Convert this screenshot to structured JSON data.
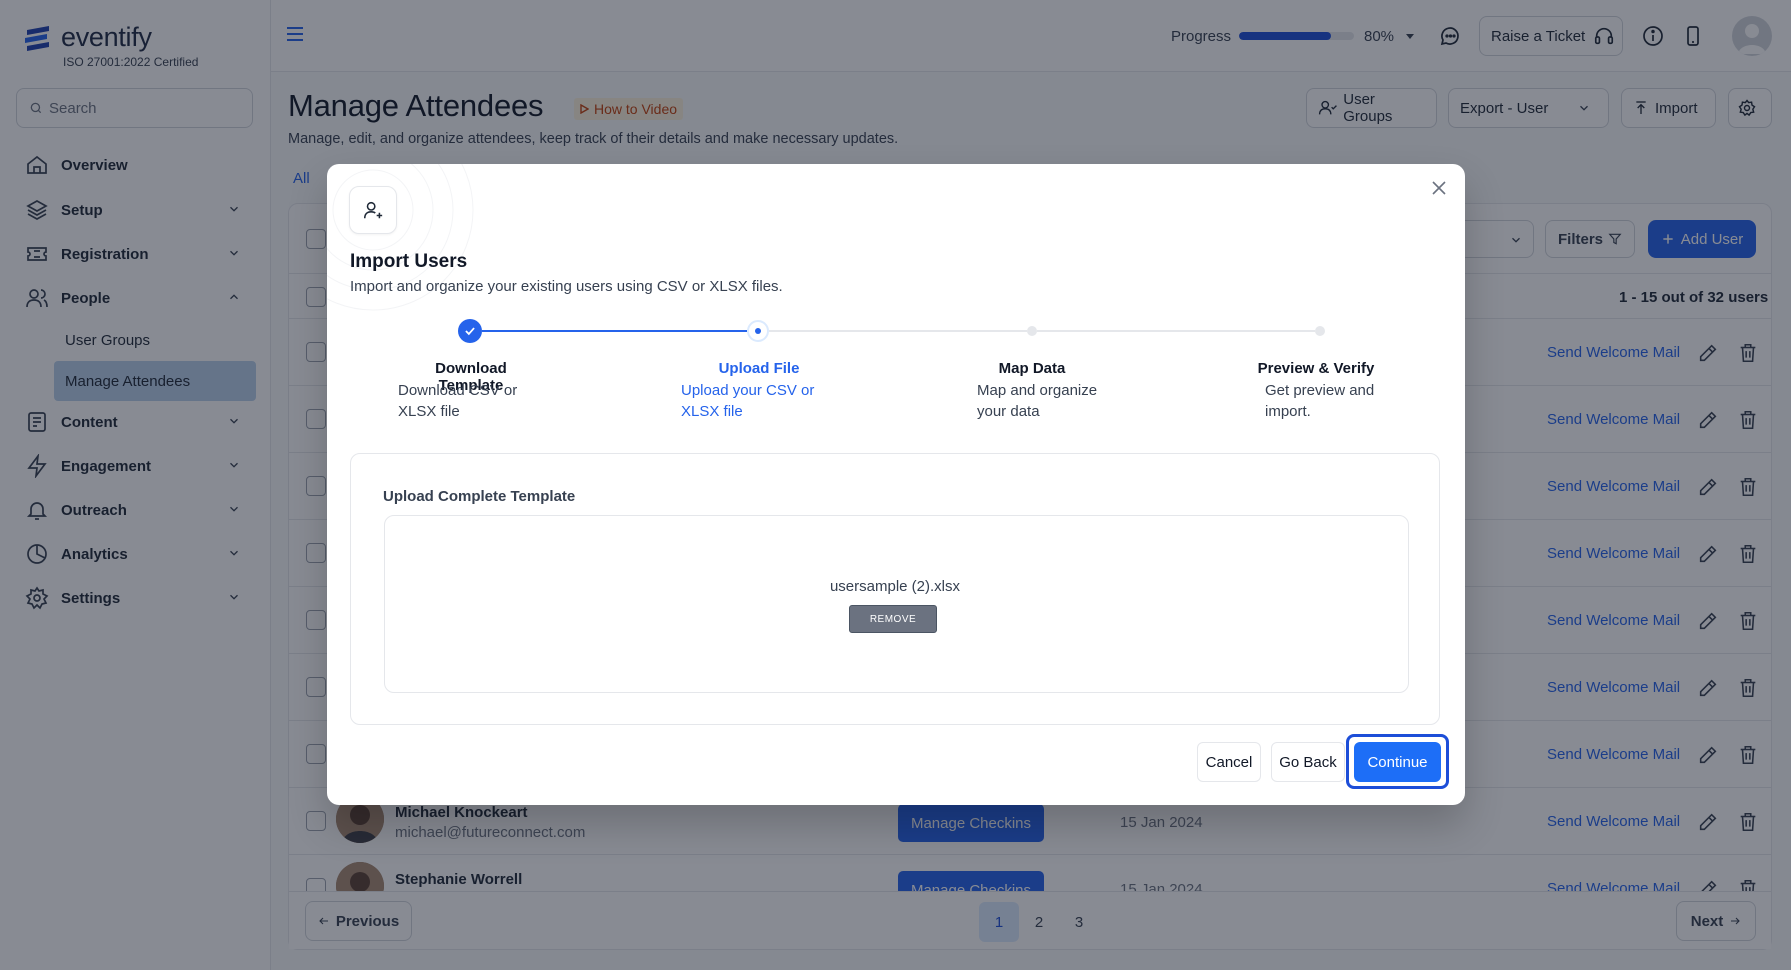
{
  "app": {
    "brand": "eventify",
    "certification": "ISO 27001:2022 Certified"
  },
  "sidebar": {
    "search_placeholder": "Search",
    "items": [
      {
        "label": "Overview",
        "icon": "home-icon"
      },
      {
        "label": "Setup",
        "icon": "layers-icon"
      },
      {
        "label": "Registration",
        "icon": "ticket-icon"
      },
      {
        "label": "People",
        "icon": "users-icon",
        "expanded": true
      },
      {
        "label": "Content",
        "icon": "document-icon"
      },
      {
        "label": "Engagement",
        "icon": "bolt-icon"
      },
      {
        "label": "Outreach",
        "icon": "bell-icon"
      },
      {
        "label": "Analytics",
        "icon": "pie-chart-icon"
      },
      {
        "label": "Settings",
        "icon": "gear-icon"
      }
    ],
    "people_sub": [
      {
        "label": "User Groups",
        "active": false
      },
      {
        "label": "Manage Attendees",
        "active": true
      }
    ]
  },
  "topbar": {
    "progress_label": "Progress",
    "progress_value": "80%",
    "progress_fraction": 0.8,
    "ticket_label": "Raise a Ticket"
  },
  "page": {
    "title": "Manage Attendees",
    "howto_label": "How to Video",
    "subtitle": "Manage, edit, and organize attendees, keep track of their details and make necessary updates.",
    "tab_all": "All",
    "buttons": {
      "user_groups": "User Groups",
      "export": "Export - User",
      "import": "Import"
    },
    "filters_label": "Filters",
    "add_user_label": "Add User",
    "count_text": "1 - 15 out of 32 users",
    "row_action": "Send Welcome Mail",
    "rows": [
      {
        "name": "Michael Knockeart",
        "email": "michael@futureconnect.com",
        "manage": "Manage Checkins",
        "date": "15 Jan 2024"
      },
      {
        "name": "Stephanie Worrell",
        "email": "",
        "manage": "Manage Checkins",
        "date": "15 Jan 2024"
      }
    ],
    "pagination": {
      "previous": "Previous",
      "next": "Next",
      "pages": [
        "1",
        "2",
        "3"
      ],
      "current": "1"
    }
  },
  "modal": {
    "title": "Import Users",
    "subtitle": "Import and organize your existing users using CSV or XLSX files.",
    "steps": [
      {
        "title": "Download Template",
        "desc_line1": "Download CSV or",
        "desc_line2": "XLSX file",
        "state": "done"
      },
      {
        "title": "Upload File",
        "desc_line1": "Upload your CSV or",
        "desc_line2": "XLSX file",
        "state": "current"
      },
      {
        "title": "Map Data",
        "desc_line1": "Map and organize",
        "desc_line2": "your data",
        "state": "todo"
      },
      {
        "title": "Preview & Verify",
        "desc_line1": "Get preview and",
        "desc_line2": "import.",
        "state": "todo"
      }
    ],
    "upload_label": "Upload Complete Template",
    "file_name": "usersample (2).xlsx",
    "remove_label": "REMOVE",
    "cancel_label": "Cancel",
    "go_back_label": "Go Back",
    "continue_label": "Continue"
  },
  "colors": {
    "primary": "#2563eb",
    "active_nav": "#b9d0ea",
    "overlay": "rgba(17,24,39,0.5)"
  }
}
